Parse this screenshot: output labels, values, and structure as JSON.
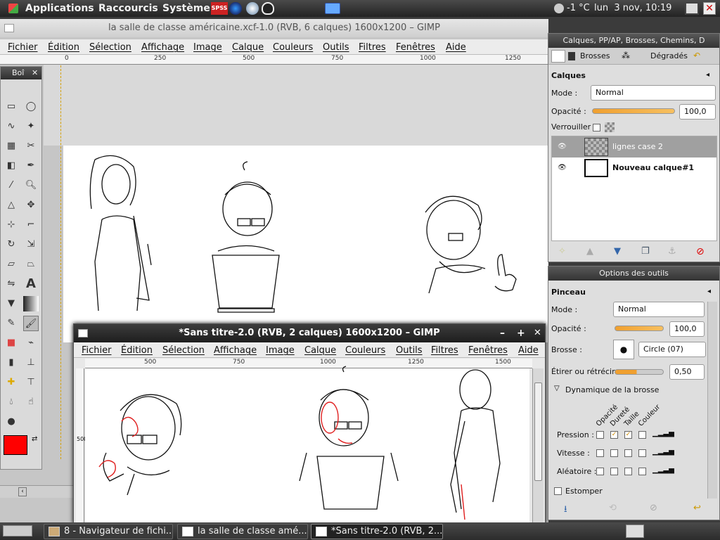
{
  "top_panel": {
    "menus": [
      "Applications",
      "Raccourcis",
      "Système"
    ],
    "spss_label": "SPSS",
    "weather": "-1 °C",
    "clock": "lun  3 nov, 10:19"
  },
  "main_window": {
    "title": "la salle de classe américaine.xcf-1.0 (RVB, 6 calques) 1600x1200 – GIMP",
    "menu": [
      "Fichier",
      "Édition",
      "Sélection",
      "Affichage",
      "Image",
      "Calque",
      "Couleurs",
      "Outils",
      "Filtres",
      "Fenêtres",
      "Aide"
    ],
    "ruler_ticks": [
      "0",
      "250",
      "500",
      "750",
      "1000",
      "1250"
    ]
  },
  "toolbox": {
    "title": "Boî",
    "fg_color": "#ff0000",
    "bg_color": "#ffffff"
  },
  "second_window": {
    "title": "*Sans titre-2.0 (RVB, 2 calques) 1600x1200 – GIMP",
    "menu": [
      "Fichier",
      "Édition",
      "Sélection",
      "Affichage",
      "Image",
      "Calque",
      "Couleurs",
      "Outils",
      "Filtres",
      "Fenêtres",
      "Aide"
    ],
    "ruler_ticks": [
      "500",
      "750",
      "1000",
      "1250",
      "1500"
    ],
    "vruler": "500"
  },
  "layers_dock": {
    "title": "Calques, PP/AP, Brosses, Chemins, D",
    "tabs": [
      "Brosses",
      "Dégradés"
    ],
    "section_title": "Calques",
    "mode_label": "Mode :",
    "mode_value": "Normal",
    "opacity_label": "Opacité :",
    "opacity_value": "100,0",
    "opacity_fraction": 1.0,
    "lock_label": "Verrouiller :",
    "layers": [
      {
        "name": "lignes case 2",
        "selected": true
      },
      {
        "name": "Nouveau calque#1",
        "selected": false
      }
    ]
  },
  "tool_options": {
    "title": "Options des outils",
    "tool_name": "Pinceau",
    "mode_label": "Mode :",
    "mode_value": "Normal",
    "opacity_label": "Opacité :",
    "opacity_value": "100,0",
    "brush_label": "Brosse :",
    "brush_value": "Circle (07)",
    "scale_label": "Étirer ou rétrécir :",
    "scale_value": "0,50",
    "dynamics_label": "Dynamique de la brosse",
    "dynamics_columns": [
      "Opacité",
      "Dureté",
      "Taille",
      "Couleur"
    ],
    "dynamics_rows": [
      {
        "label": "Pression :",
        "checks": [
          false,
          true,
          true,
          false
        ]
      },
      {
        "label": "Vitesse :",
        "checks": [
          false,
          false,
          false,
          false
        ]
      },
      {
        "label": "Aléatoire :",
        "checks": [
          false,
          false,
          false,
          false
        ]
      }
    ],
    "fade_label": "Estomper"
  },
  "taskbar": {
    "tasks": [
      {
        "label": "8 - Navigateur de fichi..."
      },
      {
        "label": "la salle de classe amé..."
      },
      {
        "label": "*Sans titre-2.0 (RVB, 2..."
      }
    ]
  }
}
